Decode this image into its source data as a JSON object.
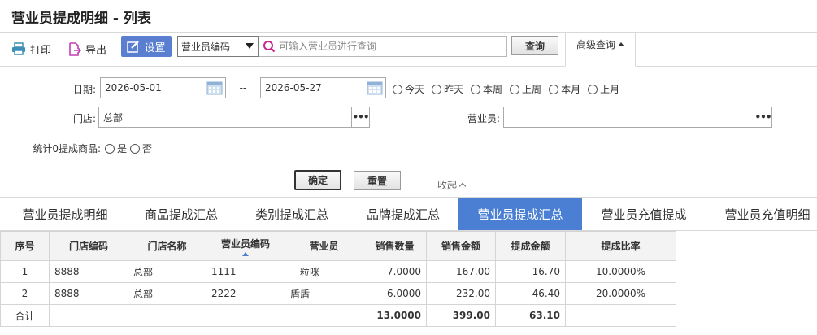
{
  "page": {
    "title": "营业员提成明细 - 列表"
  },
  "toolbar": {
    "print_label": "打印",
    "export_label": "导出",
    "settings_label": "设置",
    "field_select_value": "营业员编码",
    "search_placeholder": "可输入营业员进行查询",
    "query_label": "查询",
    "advanced_label": "高级查询"
  },
  "filters": {
    "date_label": "日期:",
    "date_from": "2026-05-01",
    "date_sep": "--",
    "date_to": "2026-05-27",
    "quick_ranges": [
      "今天",
      "昨天",
      "本周",
      "上周",
      "本月",
      "上月"
    ],
    "store_label": "门店:",
    "store_value": "总部",
    "clerk_label": "营业员:",
    "clerk_value": "",
    "zero_label": "统计0提成商品:",
    "zero_options": [
      "是",
      "否"
    ],
    "ok_label": "确定",
    "reset_label": "重置",
    "collapse_label": "收起"
  },
  "tabs": [
    "营业员提成明细",
    "商品提成汇总",
    "类别提成汇总",
    "品牌提成汇总",
    "营业员提成汇总",
    "营业员充值提成",
    "营业员充值明细"
  ],
  "active_tab": 4,
  "table": {
    "columns": [
      "序号",
      "门店编码",
      "门店名称",
      "营业员编码",
      "营业员",
      "销售数量",
      "销售金额",
      "提成金额",
      "提成比率"
    ],
    "rows": [
      [
        "1",
        "8888",
        "总部",
        "1111",
        "一粒咪",
        "7.0000",
        "167.00",
        "16.70",
        "10.0000%"
      ],
      [
        "2",
        "8888",
        "总部",
        "2222",
        "盾盾",
        "6.0000",
        "232.00",
        "46.40",
        "20.0000%"
      ]
    ],
    "total": [
      "合计",
      "",
      "",
      "",
      "",
      "13.0000",
      "399.00",
      "63.10",
      ""
    ]
  },
  "colors": {
    "accent": "#4a7fd4",
    "settings_button": "#5b7fd0"
  }
}
